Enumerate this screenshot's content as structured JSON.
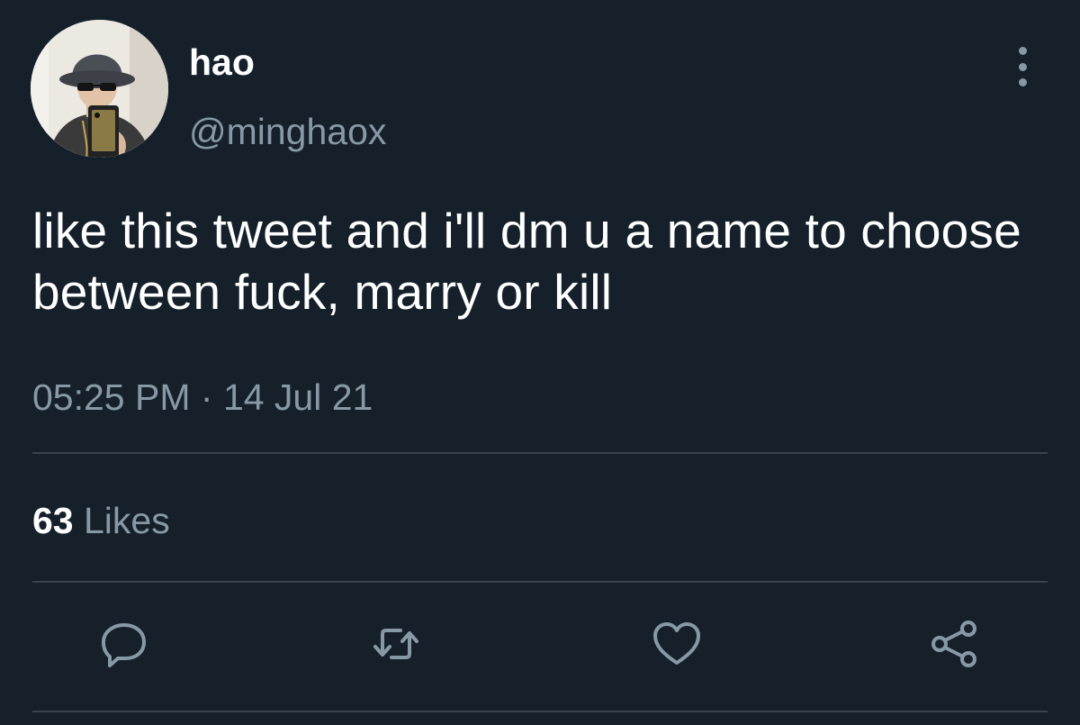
{
  "tweet": {
    "author": {
      "display_name": "hao",
      "handle": "@minghaox"
    },
    "text": "like this tweet and i'll dm u a name to choose between fuck, marry or kill",
    "time": "05:25 PM",
    "separator": " · ",
    "date": "14 Jul 21",
    "stats": {
      "likes_count": "63",
      "likes_label": " Likes"
    }
  },
  "actions": {
    "reply_icon": "reply-icon",
    "retweet_icon": "retweet-icon",
    "like_icon": "heart-icon",
    "share_icon": "share-icon",
    "more_icon": "more-vertical-icon"
  },
  "colors": {
    "background": "#15202b",
    "primary_text": "#ffffff",
    "secondary_text": "#8899a6",
    "divider": "#38444d"
  }
}
